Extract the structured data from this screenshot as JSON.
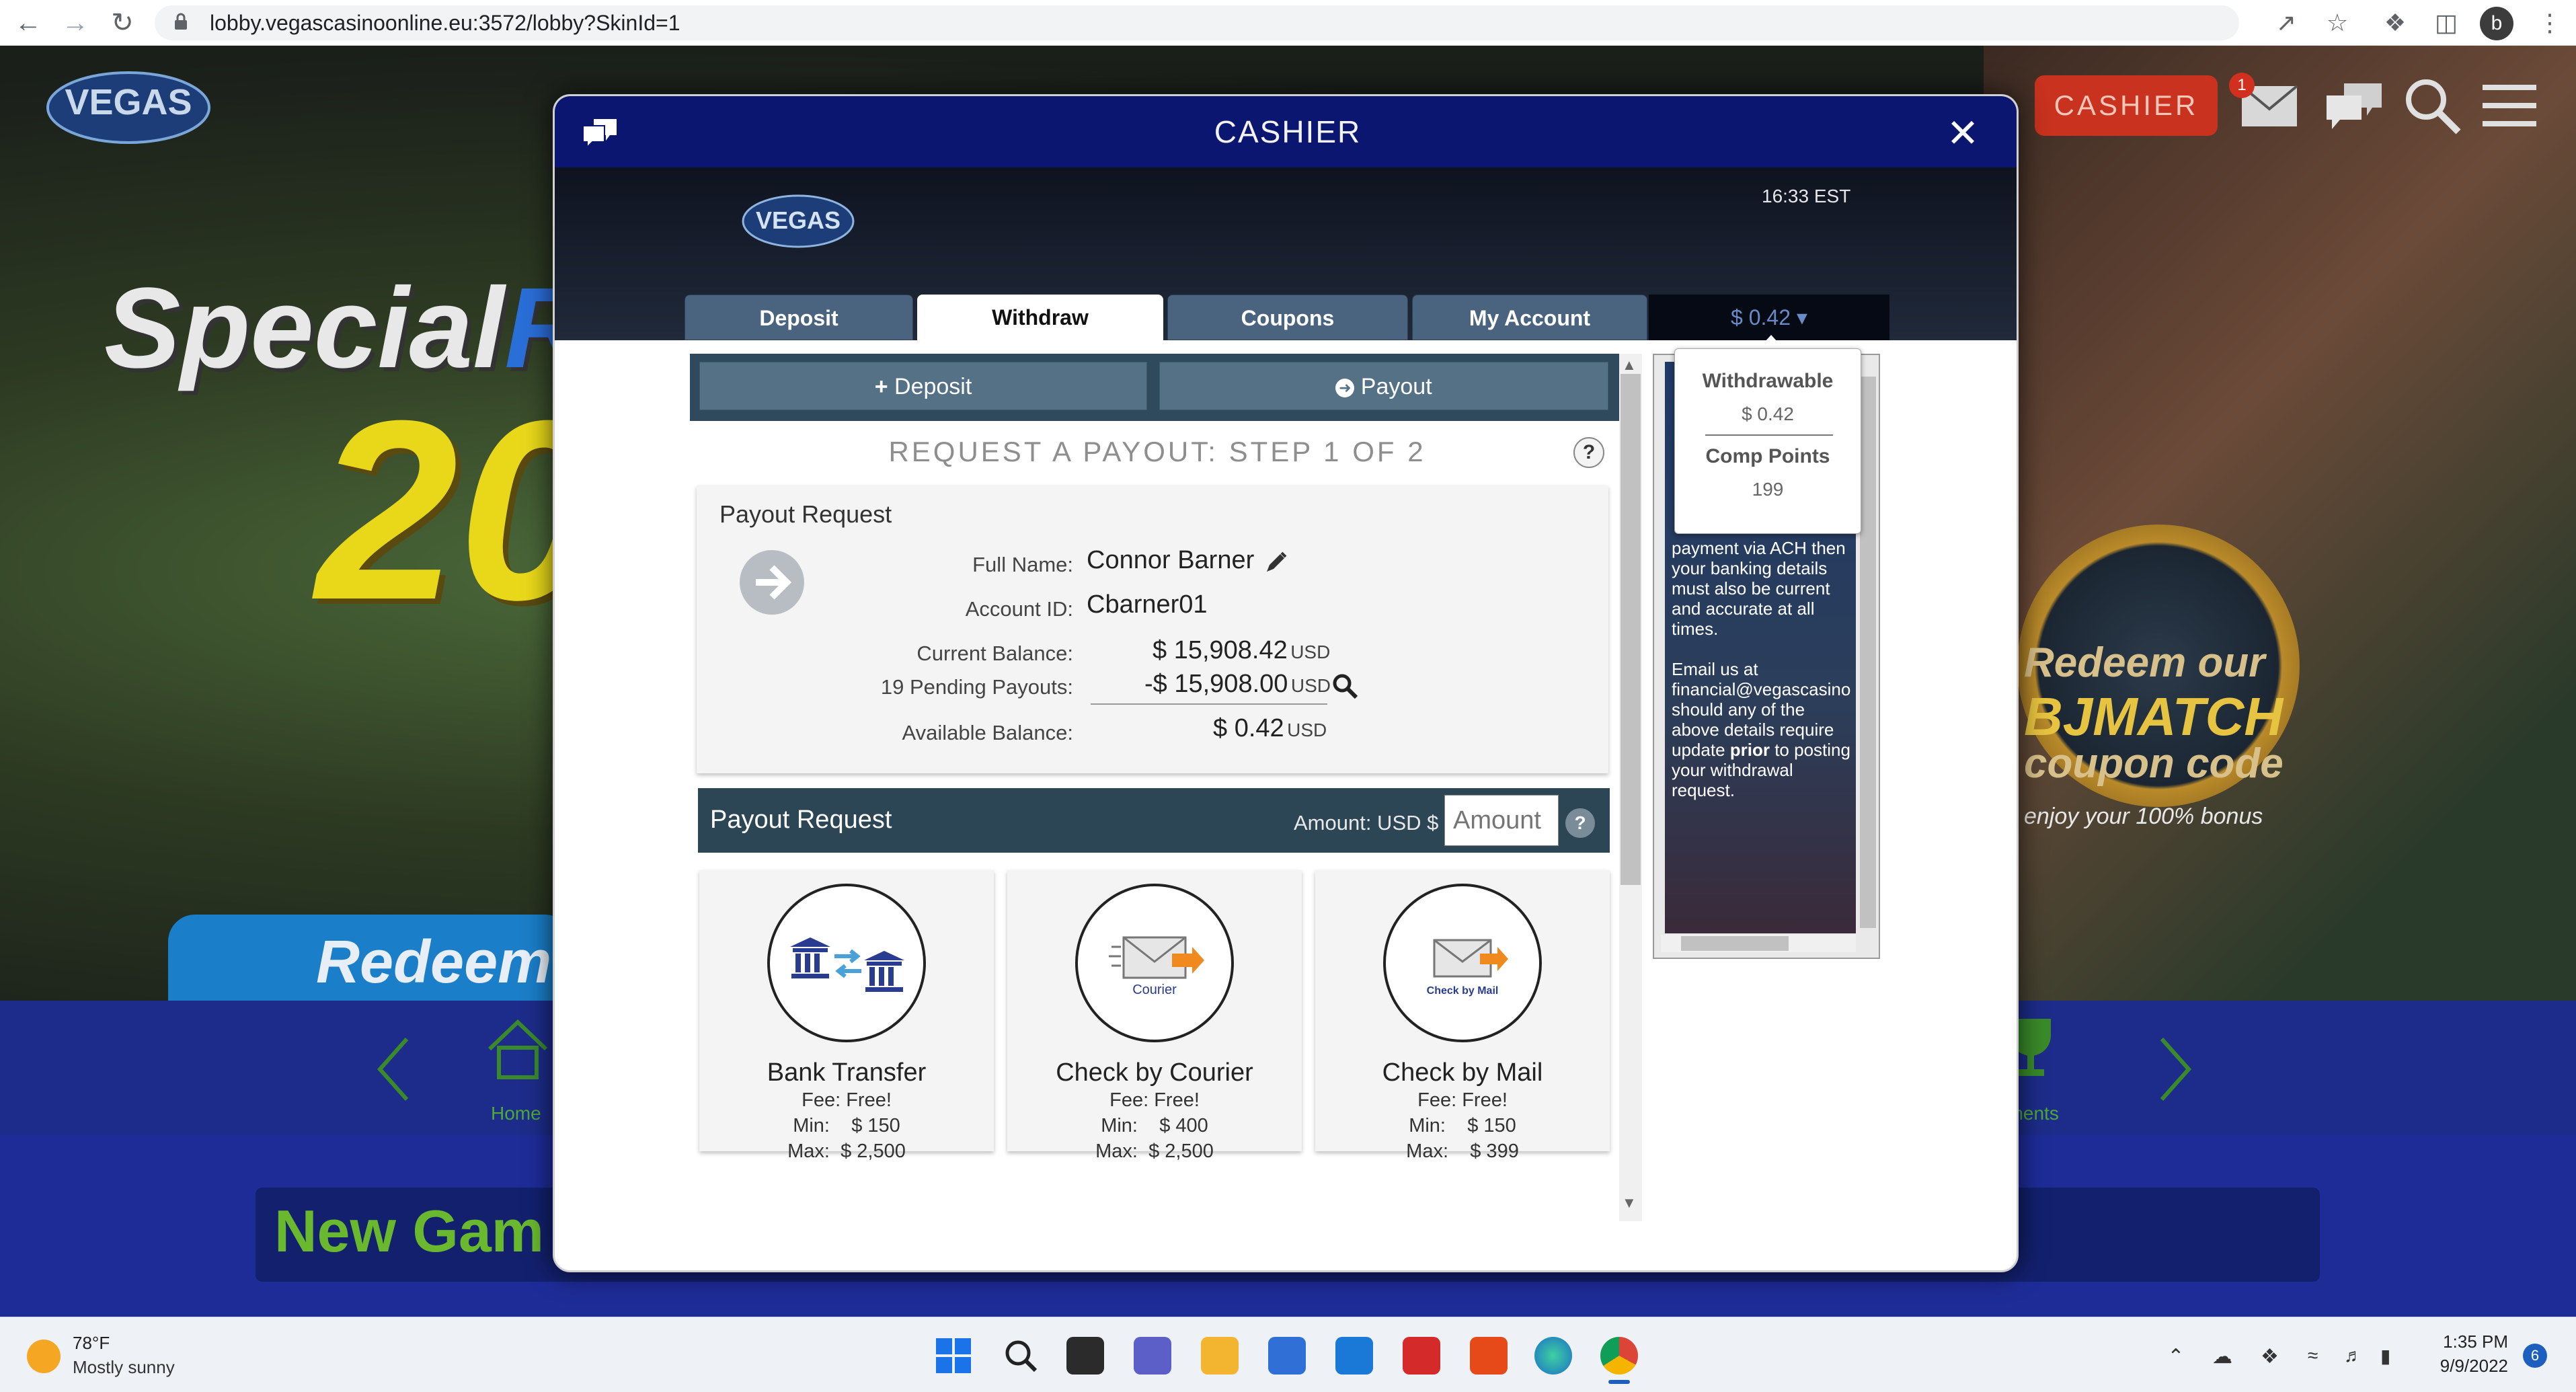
{
  "browser": {
    "url": "lobby.vegascasinoonline.eu:3572/lobby?SkinId=1",
    "profile_initial": "b",
    "icons": [
      "back-arrow-icon",
      "forward-arrow-icon",
      "reload-icon",
      "lock-icon",
      "share-icon",
      "star-icon",
      "extensions-icon",
      "sidebar-icon"
    ]
  },
  "site": {
    "logo_text": "VEGAS",
    "hero_left_text": "Special",
    "hero_left_text_accent": "R",
    "hero_number": "20",
    "redeem_text": "Redeem c",
    "badge_line1": "Redeem our",
    "badge_line2": "BJMATCH",
    "badge_line3": "coupon code",
    "badge_line4": "enjoy your 100% bonus",
    "nav_home_label": "Home",
    "nav_tournaments_label": "aments",
    "new_games_text": "New Gam",
    "header": {
      "cashier_label": "CASHIER",
      "mail_badge": "1"
    }
  },
  "cashier": {
    "title": "CASHIER",
    "clock": "16:33 EST",
    "tabs": [
      {
        "label": "Deposit",
        "active": false
      },
      {
        "label": "Withdraw",
        "active": true
      },
      {
        "label": "Coupons",
        "active": false
      },
      {
        "label": "My Account",
        "active": false
      }
    ],
    "balance_tab": "$ 0.42 ▾",
    "actions": {
      "deposit": "Deposit",
      "payout": "Payout"
    },
    "step_title": "REQUEST A PAYOUT: STEP 1 OF 2",
    "help_symbol": "?",
    "info": {
      "title": "Payout Request",
      "full_name_label": "Full Name:",
      "full_name": "Connor Barner",
      "account_id_label": "Account ID:",
      "account_id": "Cbarner01",
      "current_balance_label": "Current Balance:",
      "current_balance": "$ 15,908.42",
      "pending_label": "19 Pending Payouts:",
      "pending_amount": "-$ 15,908.00",
      "available_label": "Available Balance:",
      "available_balance": "$ 0.42",
      "currency": "USD"
    },
    "payout_bar": {
      "title": "Payout Request",
      "amount_label": "Amount:  USD $",
      "amount_placeholder": "Amount"
    },
    "methods": [
      {
        "name": "Bank Transfer",
        "fee": "Fee: Free!",
        "min_label": "Min:",
        "min": "$ 150",
        "max_label": "Max:",
        "max": "$ 2,500",
        "icon": "bank-transfer-icon",
        "icon_text": ""
      },
      {
        "name": "Check by Courier",
        "fee": "Fee: Free!",
        "min_label": "Min:",
        "min": "$ 400",
        "max_label": "Max:",
        "max": "$ 2,500",
        "icon": "courier-envelope-icon",
        "icon_text": "Courier"
      },
      {
        "name": "Check by Mail",
        "fee": "Fee: Free!",
        "min_label": "Min:",
        "min": "$ 150",
        "max_label": "Max:",
        "max": "$ 399",
        "icon": "mail-envelope-icon",
        "icon_text": "Check by Mail"
      }
    ],
    "side_panel_text_1": "payment via ACH then your banking details must also be current and accurate at all times.",
    "side_panel_text_2a": "Email us at financial@vegascasino should any of the above details require update ",
    "side_panel_text_2b": "prior",
    "side_panel_text_2c": " to posting your withdrawal request.",
    "popover": {
      "withdrawable_label": "Withdrawable",
      "withdrawable_value": "$ 0.42",
      "comp_label": "Comp Points",
      "comp_value": "199"
    }
  },
  "taskbar": {
    "temp": "78°F",
    "weather": "Mostly sunny",
    "time": "1:35 PM",
    "date": "9/9/2022",
    "notifications": "6"
  },
  "colors": {
    "modal_header": "#0b1670",
    "tab_inactive": "#4a6480",
    "action_bar": "#2e4a5c",
    "cashier_button": "#c8321e",
    "nav_green": "#4caa35"
  }
}
